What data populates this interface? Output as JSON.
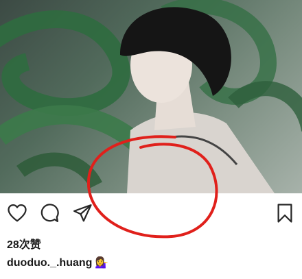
{
  "post": {
    "image_description_icon": "photo-icon"
  },
  "actions": {
    "like_icon": "heart-icon",
    "comment_icon": "comment-icon",
    "share_icon": "paper-plane-icon",
    "save_icon": "bookmark-icon"
  },
  "likes": {
    "count_text": "28次赞"
  },
  "caption": {
    "username": "duoduo._.huang",
    "emoji": "💁‍♀️"
  },
  "colors": {
    "annotation_red": "#e0201b",
    "icon_dark": "#262626"
  }
}
